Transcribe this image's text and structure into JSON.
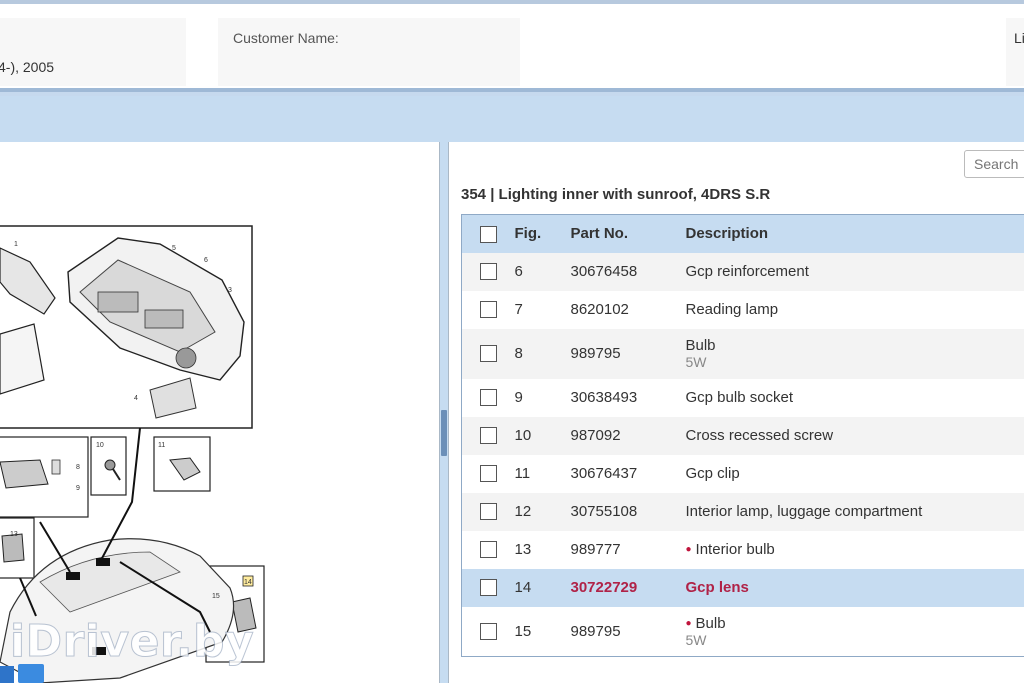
{
  "header": {
    "model_text": "4-), 2005",
    "customer_label": "Customer Name:",
    "right_label": "Li"
  },
  "search": {
    "placeholder": "Search"
  },
  "group": {
    "title": "354  |  Lighting inner with sunroof, 4DRS S.R"
  },
  "table": {
    "columns": {
      "fig": "Fig.",
      "part": "Part No.",
      "desc": "Description"
    },
    "rows": [
      {
        "fig": "6",
        "part": "30676458",
        "desc": "Gcp reinforcement",
        "sub": ""
      },
      {
        "fig": "7",
        "part": "8620102",
        "desc": "Reading lamp",
        "sub": ""
      },
      {
        "fig": "8",
        "part": "989795",
        "desc": "Bulb",
        "sub": "5W"
      },
      {
        "fig": "9",
        "part": "30638493",
        "desc": "Gcp bulb socket",
        "sub": ""
      },
      {
        "fig": "10",
        "part": "987092",
        "desc": "Cross recessed screw",
        "sub": ""
      },
      {
        "fig": "11",
        "part": "30676437",
        "desc": "Gcp clip",
        "sub": ""
      },
      {
        "fig": "12",
        "part": "30755108",
        "desc": "Interior lamp, luggage compartment",
        "sub": ""
      },
      {
        "fig": "13",
        "part": "989777",
        "desc": "Interior bulb",
        "sub": ""
      },
      {
        "fig": "14",
        "part": "30722729",
        "desc": "Gcp lens",
        "sub": ""
      },
      {
        "fig": "15",
        "part": "989795",
        "desc": "Bulb",
        "sub": "5W"
      }
    ]
  },
  "diagram": {
    "labels": [
      "1",
      "5",
      "6",
      "3",
      "4",
      "10",
      "11",
      "8",
      "9",
      "13",
      "14",
      "15"
    ]
  },
  "watermark": "iDriver.by",
  "colors": {
    "accent": "#c6dcf1",
    "selected_text": "#b02247",
    "bullet": "#c0143c"
  }
}
